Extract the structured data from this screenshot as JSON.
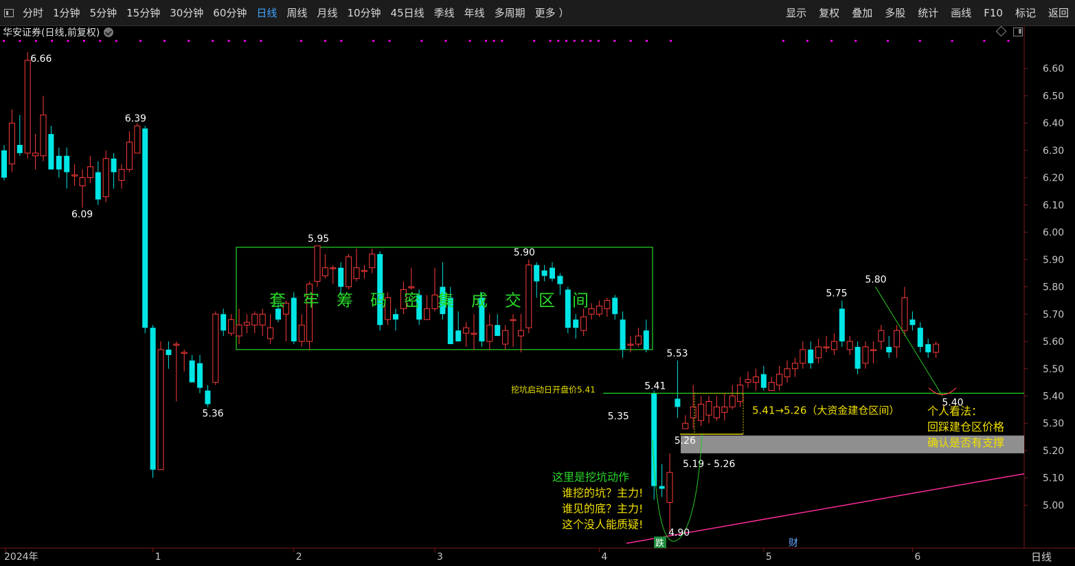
{
  "toolbar": {
    "periods": [
      "分时",
      "1分钟",
      "5分钟",
      "15分钟",
      "30分钟",
      "60分钟",
      "日线",
      "周线",
      "月线",
      "10分钟",
      "45日线",
      "季线",
      "年线",
      "多周期",
      "更多 ）"
    ],
    "active_period": "日线",
    "right_items": [
      "显示",
      "复权",
      "叠加",
      "多股",
      "统计",
      "画线",
      "F10",
      "标记",
      "返回"
    ]
  },
  "stock": {
    "title": "华安证券(日线,前复权)"
  },
  "period_label": "日线",
  "colors": {
    "up": "#ff3b3b",
    "down": "#00e5e5",
    "box": "#28d828",
    "zone_text": "#f0e000",
    "trend": "#ff2a9a",
    "grid": "#3a1a1a"
  },
  "chart_data": {
    "type": "candlestick",
    "ylim": [
      4.85,
      6.7
    ],
    "yticks": [
      5.0,
      5.1,
      5.2,
      5.3,
      5.4,
      5.5,
      5.6,
      5.7,
      5.8,
      5.9,
      6.0,
      6.1,
      6.2,
      6.3,
      6.4,
      6.5,
      6.6
    ],
    "xaxis_labels": [
      {
        "label": "2024年",
        "index": 1
      },
      {
        "label": "1",
        "index": 19
      },
      {
        "label": "2",
        "index": 37
      },
      {
        "label": "3",
        "index": 55
      },
      {
        "label": "4",
        "index": 76
      },
      {
        "label": "5",
        "index": 97
      },
      {
        "label": "6",
        "index": 116
      }
    ],
    "candles": [
      [
        6.3,
        6.2,
        6.32,
        6.19
      ],
      [
        6.25,
        6.4,
        6.45,
        6.22
      ],
      [
        6.32,
        6.29,
        6.43,
        6.28
      ],
      [
        6.29,
        6.63,
        6.66,
        6.27
      ],
      [
        6.28,
        6.29,
        6.36,
        6.23
      ],
      [
        6.28,
        6.43,
        6.5,
        6.26
      ],
      [
        6.36,
        6.23,
        6.39,
        6.23
      ],
      [
        6.28,
        6.23,
        6.31,
        6.2
      ],
      [
        6.28,
        6.22,
        6.31,
        6.16
      ],
      [
        6.21,
        6.21,
        6.25,
        6.17
      ],
      [
        6.17,
        6.2,
        6.23,
        6.09
      ],
      [
        6.2,
        6.24,
        6.28,
        6.18
      ],
      [
        6.22,
        6.12,
        6.26,
        6.1
      ],
      [
        6.13,
        6.27,
        6.3,
        6.11
      ],
      [
        6.27,
        6.22,
        6.29,
        6.16
      ],
      [
        6.19,
        6.23,
        6.25,
        6.16
      ],
      [
        6.23,
        6.33,
        6.37,
        6.22
      ],
      [
        6.29,
        6.39,
        6.4,
        6.29
      ],
      [
        6.38,
        5.65,
        6.39,
        5.63
      ],
      [
        5.65,
        5.13,
        5.66,
        5.1
      ],
      [
        5.13,
        5.57,
        5.6,
        5.55
      ],
      [
        5.57,
        5.55,
        5.6,
        5.5
      ],
      [
        5.59,
        5.59,
        5.6,
        5.38
      ],
      [
        5.56,
        5.56,
        5.57,
        5.49
      ],
      [
        5.53,
        5.45,
        5.55,
        5.45
      ],
      [
        5.52,
        5.43,
        5.55,
        5.41
      ],
      [
        5.42,
        5.37,
        5.44,
        5.36
      ],
      [
        5.45,
        5.7,
        5.71,
        5.44
      ],
      [
        5.7,
        5.64,
        5.72,
        5.62
      ],
      [
        5.63,
        5.68,
        5.7,
        5.62
      ],
      [
        5.62,
        5.66,
        5.72,
        5.59
      ],
      [
        5.66,
        5.67,
        5.7,
        5.63
      ],
      [
        5.66,
        5.7,
        5.71,
        5.63
      ],
      [
        5.66,
        5.7,
        5.72,
        5.62
      ],
      [
        5.61,
        5.65,
        5.7,
        5.59
      ],
      [
        5.72,
        5.68,
        5.74,
        5.67
      ],
      [
        5.7,
        5.74,
        5.75,
        5.6
      ],
      [
        5.76,
        5.6,
        5.78,
        5.59
      ],
      [
        5.6,
        5.66,
        5.7,
        5.58
      ],
      [
        5.6,
        5.81,
        5.82,
        5.57
      ],
      [
        5.82,
        5.95,
        5.95,
        5.8
      ],
      [
        5.84,
        5.87,
        5.92,
        5.83
      ],
      [
        5.87,
        5.87,
        5.88,
        5.81
      ],
      [
        5.87,
        5.8,
        5.89,
        5.77
      ],
      [
        5.8,
        5.91,
        5.92,
        5.79
      ],
      [
        5.83,
        5.87,
        5.94,
        5.82
      ],
      [
        5.86,
        5.86,
        5.88,
        5.83
      ],
      [
        5.87,
        5.92,
        5.94,
        5.85
      ],
      [
        5.92,
        5.66,
        5.93,
        5.64
      ],
      [
        5.68,
        5.76,
        5.78,
        5.66
      ],
      [
        5.7,
        5.68,
        5.72,
        5.64
      ],
      [
        5.72,
        5.79,
        5.82,
        5.7
      ],
      [
        5.8,
        5.8,
        5.87,
        5.79
      ],
      [
        5.77,
        5.68,
        5.79,
        5.66
      ],
      [
        5.68,
        5.72,
        5.77,
        5.68
      ],
      [
        5.72,
        5.77,
        5.87,
        5.71
      ],
      [
        5.8,
        5.7,
        5.89,
        5.68
      ],
      [
        5.76,
        5.59,
        5.8,
        5.59
      ],
      [
        5.64,
        5.6,
        5.71,
        5.6
      ],
      [
        5.63,
        5.65,
        5.67,
        5.58
      ],
      [
        5.63,
        5.63,
        5.7,
        5.57
      ],
      [
        5.76,
        5.6,
        5.78,
        5.58
      ],
      [
        5.6,
        5.66,
        5.7,
        5.57
      ],
      [
        5.66,
        5.62,
        5.7,
        5.62
      ],
      [
        5.59,
        5.64,
        5.66,
        5.57
      ],
      [
        5.68,
        5.68,
        5.7,
        5.58
      ],
      [
        5.62,
        5.64,
        5.7,
        5.56
      ],
      [
        5.65,
        5.88,
        5.9,
        5.63
      ],
      [
        5.88,
        5.82,
        5.89,
        5.76
      ],
      [
        5.86,
        5.84,
        5.88,
        5.82
      ],
      [
        5.87,
        5.83,
        5.89,
        5.82
      ],
      [
        5.84,
        5.81,
        5.85,
        5.77
      ],
      [
        5.79,
        5.65,
        5.8,
        5.63
      ],
      [
        5.68,
        5.65,
        5.7,
        5.61
      ],
      [
        5.64,
        5.69,
        5.72,
        5.62
      ],
      [
        5.7,
        5.72,
        5.74,
        5.68
      ],
      [
        5.7,
        5.73,
        5.75,
        5.69
      ],
      [
        5.72,
        5.75,
        5.76,
        5.69
      ],
      [
        5.76,
        5.7,
        5.77,
        5.68
      ],
      [
        5.68,
        5.57,
        5.71,
        5.54
      ],
      [
        5.59,
        5.59,
        5.62,
        5.56
      ],
      [
        5.59,
        5.62,
        5.65,
        5.58
      ],
      [
        5.64,
        5.57,
        5.68,
        5.56
      ],
      [
        5.41,
        5.07,
        5.42,
        5.02
      ],
      [
        5.07,
        5.06,
        5.15,
        5.03
      ],
      [
        5.01,
        5.12,
        5.19,
        4.9
      ],
      [
        5.39,
        5.36,
        5.53,
        5.32
      ],
      [
        5.28,
        5.3,
        5.33,
        5.28
      ],
      [
        5.32,
        5.36,
        5.44,
        5.28
      ],
      [
        5.31,
        5.37,
        5.4,
        5.29
      ],
      [
        5.33,
        5.38,
        5.4,
        5.3
      ],
      [
        5.32,
        5.36,
        5.4,
        5.31
      ],
      [
        5.34,
        5.36,
        5.41,
        5.31
      ],
      [
        5.36,
        5.4,
        5.44,
        5.35
      ],
      [
        5.38,
        5.44,
        5.47,
        5.36
      ],
      [
        5.45,
        5.46,
        5.49,
        5.43
      ],
      [
        5.45,
        5.47,
        5.5,
        5.42
      ],
      [
        5.48,
        5.43,
        5.51,
        5.42
      ],
      [
        5.42,
        5.45,
        5.47,
        5.43
      ],
      [
        5.44,
        5.48,
        5.51,
        5.42
      ],
      [
        5.47,
        5.5,
        5.53,
        5.45
      ],
      [
        5.5,
        5.52,
        5.54,
        5.47
      ],
      [
        5.52,
        5.57,
        5.6,
        5.5
      ],
      [
        5.57,
        5.52,
        5.6,
        5.5
      ],
      [
        5.54,
        5.58,
        5.61,
        5.52
      ],
      [
        5.58,
        5.58,
        5.62,
        5.56
      ],
      [
        5.57,
        5.6,
        5.63,
        5.55
      ],
      [
        5.72,
        5.6,
        5.75,
        5.58
      ],
      [
        5.57,
        5.6,
        5.62,
        5.55
      ],
      [
        5.58,
        5.5,
        5.6,
        5.48
      ],
      [
        5.52,
        5.58,
        5.6,
        5.5
      ],
      [
        5.57,
        5.57,
        5.6,
        5.52
      ],
      [
        5.6,
        5.64,
        5.66,
        5.57
      ],
      [
        5.58,
        5.56,
        5.62,
        5.54
      ],
      [
        5.58,
        5.64,
        5.66,
        5.54
      ],
      [
        5.64,
        5.76,
        5.8,
        5.62
      ],
      [
        5.68,
        5.66,
        5.71,
        5.64
      ],
      [
        5.65,
        5.58,
        5.67,
        5.56
      ],
      [
        5.59,
        5.56,
        5.61,
        5.54
      ],
      [
        5.56,
        5.59,
        5.6,
        5.54
      ]
    ],
    "labels": [
      {
        "text": "6.66",
        "price": 6.66,
        "index": 3,
        "dx": 16
      },
      {
        "text": "6.09",
        "price": 6.09,
        "index": 10,
        "dx": -4
      },
      {
        "text": "6.39",
        "price": 6.39,
        "index": 17,
        "dx": -6
      },
      {
        "text": "5.36",
        "price": 5.36,
        "index": 26,
        "dx": 4
      },
      {
        "text": "5.95",
        "price": 5.95,
        "index": 40,
        "dx": -2
      },
      {
        "text": "5.90",
        "price": 5.9,
        "index": 67,
        "dx": -10
      },
      {
        "text": "5.35",
        "price": 5.35,
        "index": 79,
        "dx": -10
      },
      {
        "text": "5.41",
        "price": 5.41,
        "index": 83,
        "dx": -2
      },
      {
        "text": "5.53",
        "price": 5.53,
        "index": 86,
        "dx": -4
      },
      {
        "text": "5.26",
        "price": 5.26,
        "index": 87,
        "dx": -4
      },
      {
        "text": "4.90",
        "price": 4.9,
        "index": 85,
        "dx": 10
      },
      {
        "text": "5.75",
        "price": 5.75,
        "index": 106,
        "dx": 0
      },
      {
        "text": "5.80",
        "price": 5.8,
        "index": 111,
        "dx": 0
      },
      {
        "text": "5.40",
        "price": 5.4,
        "index": 121,
        "dx": -2
      }
    ],
    "box_text": [
      "套",
      "牢",
      "筹",
      "码",
      "密",
      "集",
      "成",
      "交",
      "区",
      "间"
    ],
    "line_label": "挖坑启动日开盘价5.41",
    "zone_label": "5.41→5.26（大资金建仓区间）",
    "gray_label": "5.19 - 5.26",
    "pit_note": [
      "这里是挖坑动作",
      "谁挖的坑？主力!",
      "谁见的底？主力!",
      "这个没人能质疑!"
    ],
    "opinion_note": [
      "个人看法：",
      "回踩建仓区价格",
      "确认是否有支撑"
    ],
    "badges": [
      "跌",
      "财"
    ]
  }
}
